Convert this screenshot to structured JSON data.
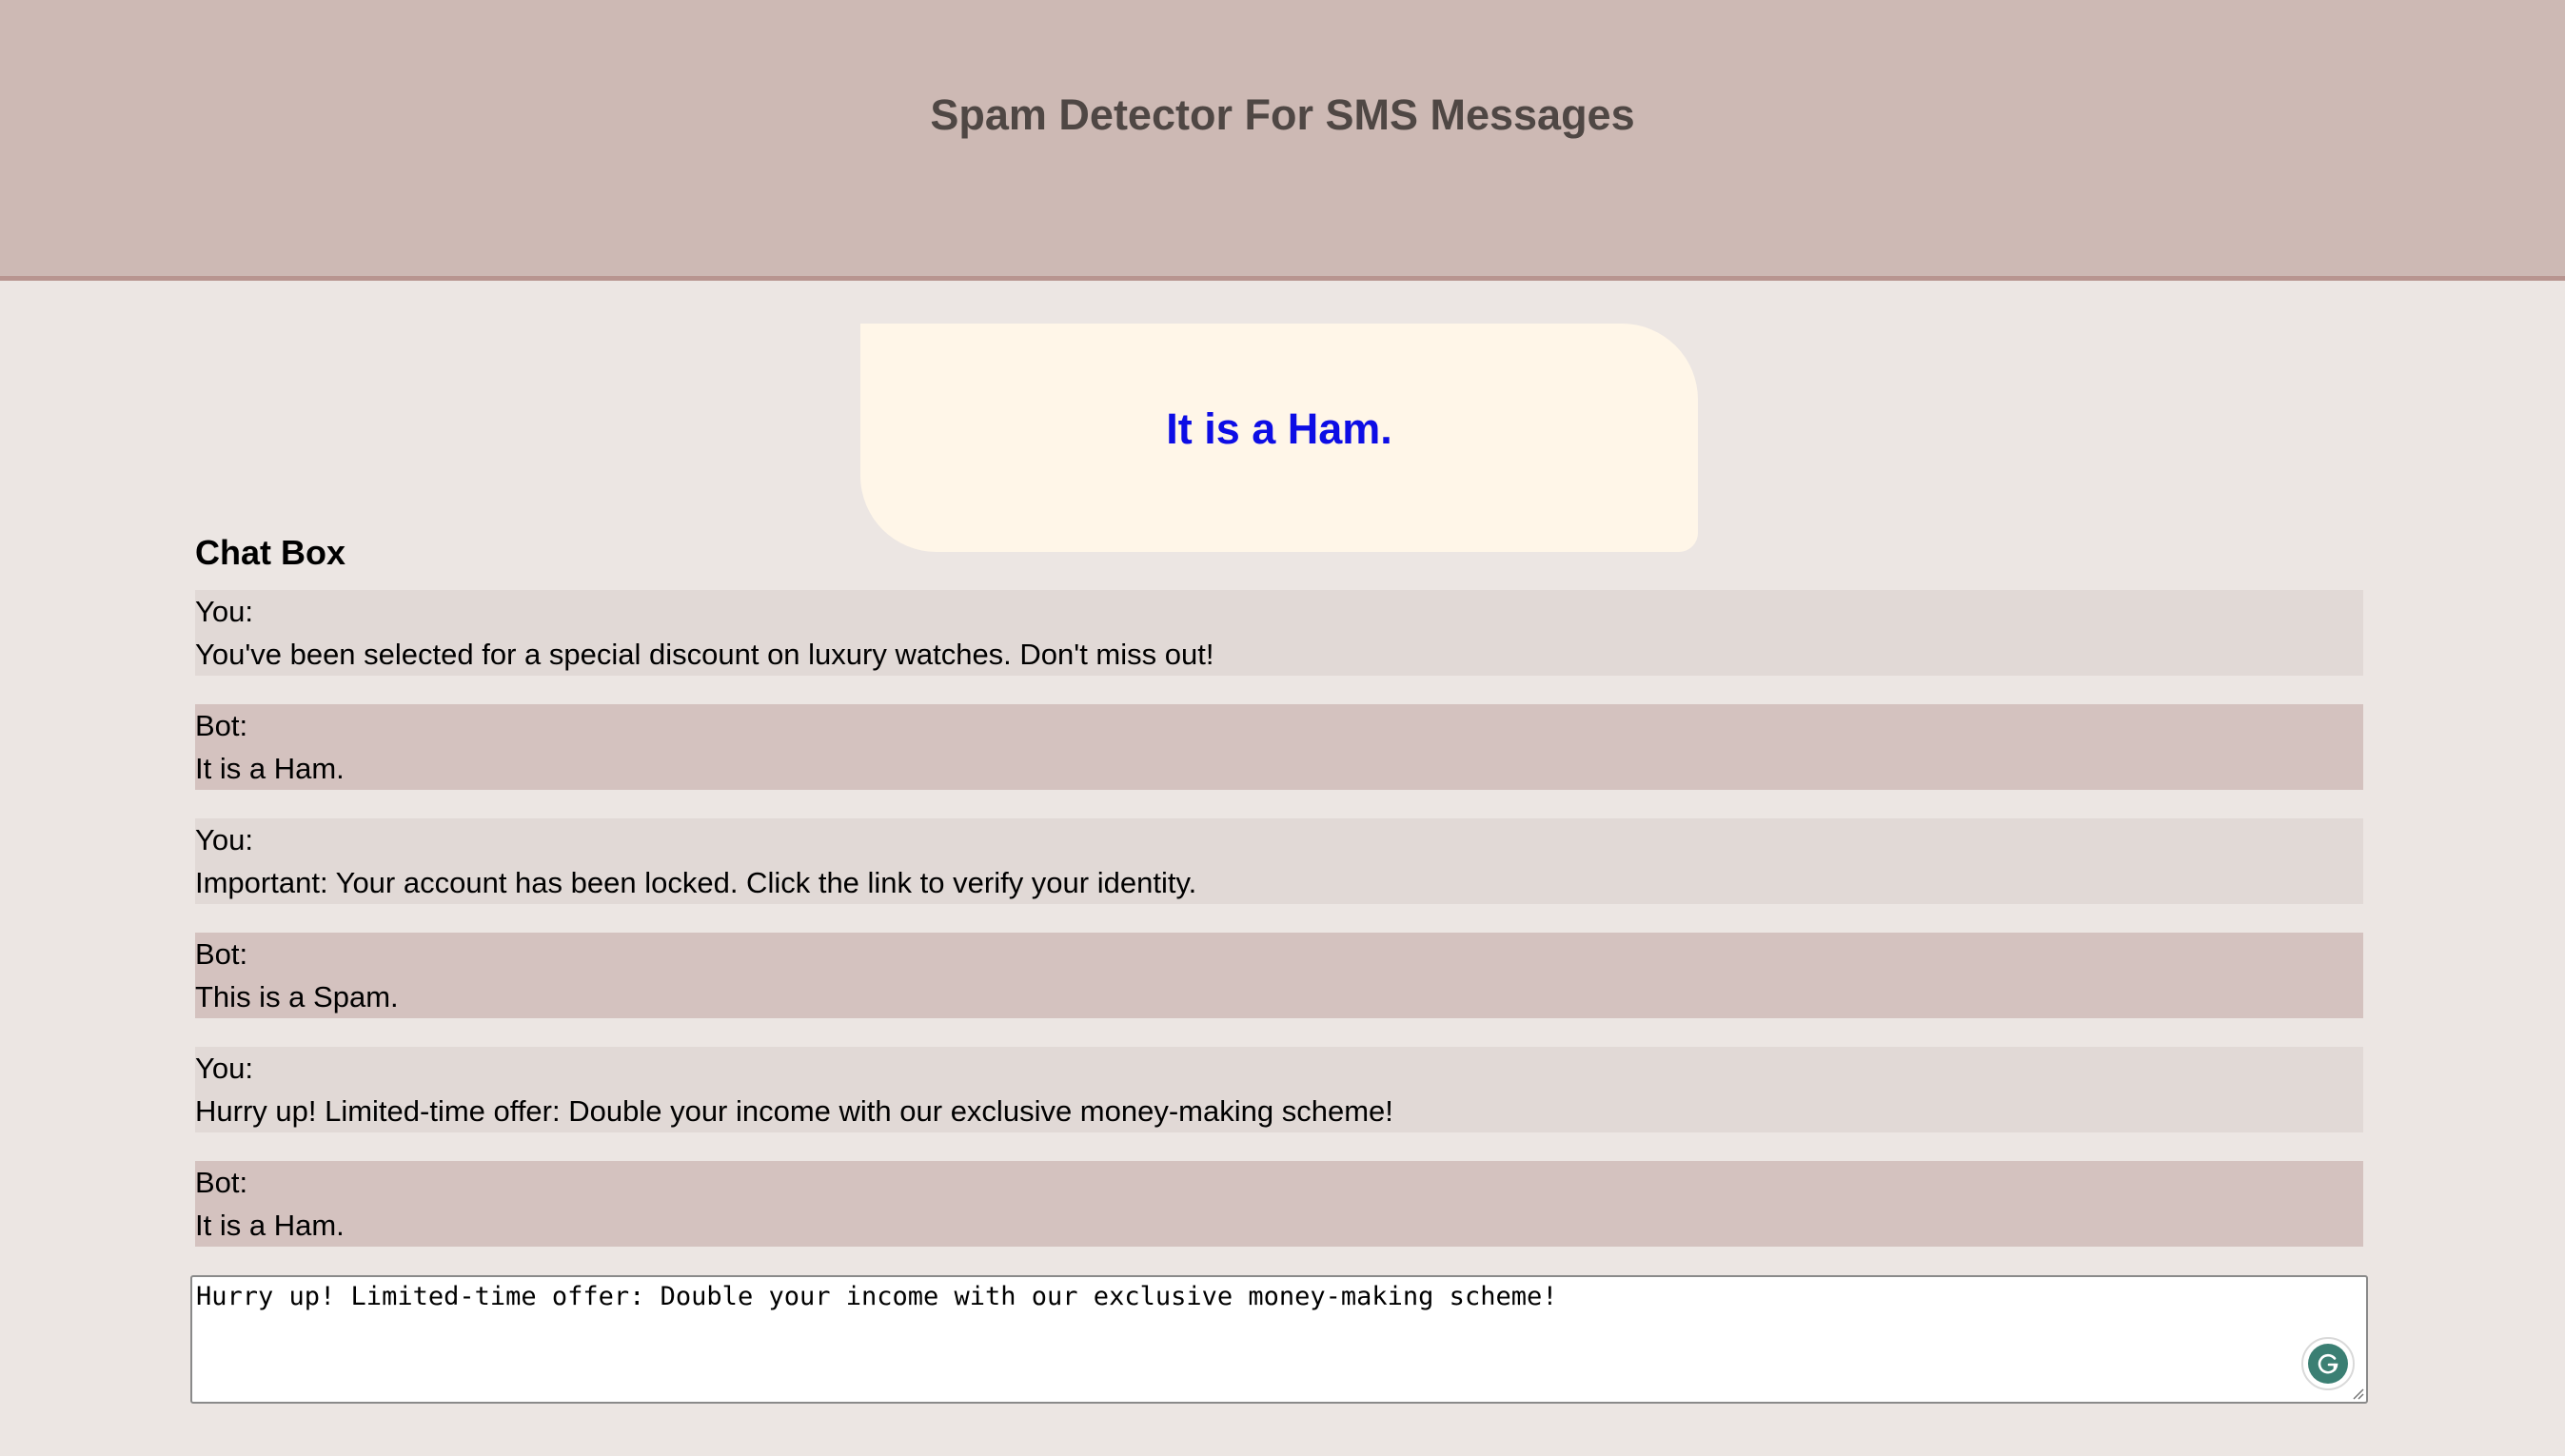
{
  "header": {
    "title": "Spam Detector For SMS Messages"
  },
  "result": {
    "text": "It is a Ham.",
    "color": "#0d0de5"
  },
  "chat": {
    "title": "Chat Box",
    "messages": [
      {
        "sender": "You:",
        "text": "You've been selected for a special discount on luxury watches. Don't miss out!"
      },
      {
        "sender": "Bot:",
        "text": "It is a Ham."
      },
      {
        "sender": "You:",
        "text": "Important: Your account has been locked. Click the link to verify your identity."
      },
      {
        "sender": "Bot:",
        "text": "This is a Spam."
      },
      {
        "sender": "You:",
        "text": "Hurry up! Limited-time offer: Double your income with our exclusive money-making scheme!"
      },
      {
        "sender": "Bot:",
        "text": "It is a Ham."
      }
    ]
  },
  "input": {
    "value": "Hurry up! Limited-time offer: Double your income with our exclusive money-making scheme!"
  },
  "icons": {
    "grammarly": "grammarly-icon",
    "resize": "resize-handle-icon"
  },
  "colors": {
    "header_bg": "#cdb9b4",
    "page_bg": "#ece6e3",
    "card_bg": "#fff6e8",
    "user_msg_bg": "#e1d9d6",
    "bot_msg_bg": "#d4c2bf",
    "grammarly": "#3b7f73"
  }
}
